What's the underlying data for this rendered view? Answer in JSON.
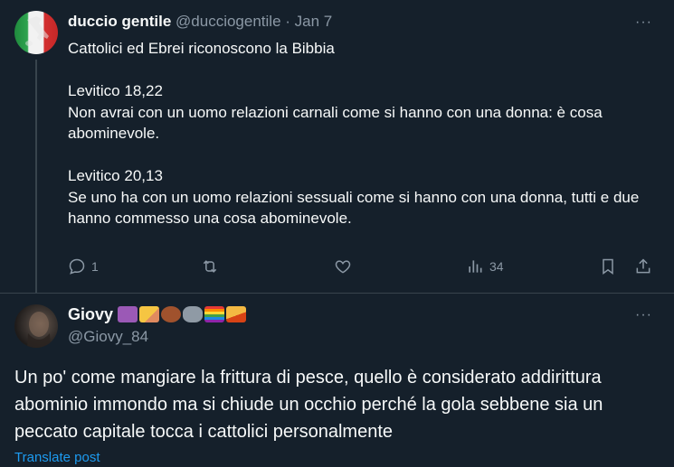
{
  "tweet": {
    "author_name": "duccio gentile",
    "handle": "@ducciogentile",
    "separator": "·",
    "date": "Jan 7",
    "lines": [
      "Cattolici ed Ebrei riconoscono la Bibbia",
      "",
      "Levitico 18,22",
      "Non avrai con un uomo relazioni carnali come si hanno con una donna: è cosa abominevole.",
      "",
      "Levitico 20,13",
      "Se uno ha con un uomo relazioni sessuali come si hanno con una donna, tutti e due hanno commesso una cosa abominevole."
    ],
    "reply_count": "1",
    "view_count": "34",
    "more_label": "···"
  },
  "reply": {
    "author_name": "Giovy",
    "handle": "@Giovy_84",
    "more_label": "···",
    "text": "Un po' come mangiare la frittura di pesce, quello è considerato addirittura abominio immondo ma si chiude un occhio perché la gola sebbene sia un peccato capitale tocca i cattolici personalmente",
    "translate_label": "Translate post",
    "emoji_icons": [
      "aquarius-icon",
      "pencil-icon",
      "bear-icon",
      "wolf-icon",
      "rainbow-flag-icon",
      "pizza-icon"
    ]
  },
  "colors": {
    "background": "#15202b",
    "text": "#f7f9f9",
    "muted": "#8b98a5",
    "divider": "#38444d",
    "link": "#1d9bf0"
  }
}
